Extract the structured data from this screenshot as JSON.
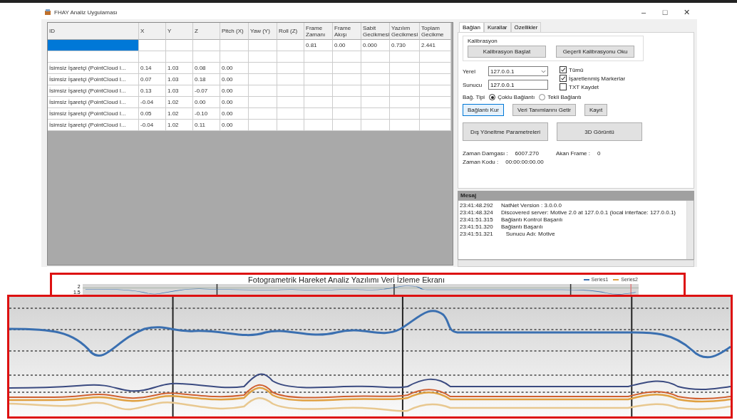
{
  "window": {
    "title": "FHAY Analiz Uygulaması",
    "controls": [
      "–",
      "□",
      "✕"
    ]
  },
  "table": {
    "columns": [
      "ID",
      "X",
      "Y",
      "Z",
      "Pitch (X)",
      "Yaw (Y)",
      "Roll (Z)",
      "Frame Zamanı",
      "Frame Akışı",
      "Sabit Gecikmesi",
      "Yazılım Gecikmesi",
      "Toplam Gecikme"
    ],
    "rows": [
      {
        "selected": true,
        "cells": [
          null,
          null,
          null,
          null,
          null,
          null,
          null,
          "0.81",
          "0.00",
          "0.000",
          "0.730",
          "2.441"
        ]
      },
      {
        "selected": false,
        "cells": []
      },
      {
        "selected": false,
        "cells": [
          "İsimsiz İşaretçi (PointCloud I...",
          "0.14",
          "1.03",
          "0.08",
          "0.00"
        ]
      },
      {
        "selected": false,
        "cells": [
          "İsimsiz İşaretçi (PointCloud I...",
          "0.07",
          "1.03",
          "0.18",
          "0.00"
        ]
      },
      {
        "selected": false,
        "cells": [
          "İsimsiz İşaretçi (PointCloud I...",
          "0.13",
          "1.03",
          "-0.07",
          "0.00"
        ]
      },
      {
        "selected": false,
        "cells": [
          "İsimsiz İşaretçi (PointCloud I...",
          "-0.04",
          "1.02",
          "0.00",
          "0.00"
        ]
      },
      {
        "selected": false,
        "cells": [
          "İsimsiz İşaretçi (PointCloud I...",
          "0.05",
          "1.02",
          "-0.10",
          "0.00"
        ]
      },
      {
        "selected": false,
        "cells": [
          "İsimsiz İşaretçi (PointCloud I...",
          "-0.04",
          "1.02",
          "0.11",
          "0.00"
        ]
      }
    ]
  },
  "panel": {
    "tabs": [
      {
        "label": "Bağlan",
        "selected": true
      },
      {
        "label": "Kurallar",
        "selected": false
      },
      {
        "label": "Özellikler",
        "selected": false
      }
    ],
    "calibration": {
      "title": "Kalibrasyon",
      "buttons": [
        {
          "label": "Kalibrasyon Başlat",
          "focused": false
        },
        {
          "label": "Geçerli Kalibrasyonu Oku",
          "focused": false
        }
      ]
    },
    "local": {
      "label": "Yerel",
      "value": "127.0.0.1"
    },
    "server": {
      "label": "Sunucu",
      "value": "127.0.0.1"
    },
    "checkboxes": [
      {
        "label": "Tümü",
        "checked": true
      },
      {
        "label": "İşaretlenmiş Markerlar",
        "checked": true
      },
      {
        "label": "TXT Kaydet",
        "checked": false
      }
    ],
    "connection_type": {
      "label": "Bağ. Tipi",
      "options": [
        {
          "label": "Çoklu Bağlantı",
          "selected": true
        },
        {
          "label": "Tekli Bağlantı",
          "selected": false
        }
      ]
    },
    "buttons": [
      {
        "label": "Bağlantı Kur",
        "focused": true
      },
      {
        "label": "Veri Tanımlarını Getir",
        "focused": false
      },
      {
        "label": "Kayıt",
        "focused": false
      }
    ],
    "big_buttons": [
      {
        "label": "Dış Yöneltme Parametreleri",
        "focused": false
      },
      {
        "label": "3D Görüntü",
        "focused": false
      }
    ],
    "info": [
      {
        "label": "Zaman Damgası :",
        "value": "6007.270"
      },
      {
        "label": "Akan Frame :",
        "value": "0"
      },
      {
        "label": "Zaman Kodu   :",
        "value": "00:00:00:00.00"
      }
    ],
    "messages": {
      "title": "Mesaj",
      "lines": [
        {
          "time": "23:41:48.292",
          "text": "NatNet Version : 3.0.0.0"
        },
        {
          "time": "23:41:48.324",
          "text": "Discovered server: Motive 2.0 at 127.0.0.1 (local interface: 127.0.0.1)"
        },
        {
          "time": "23:41:51.315",
          "text": "Bağlantı Kontrol Başarılı"
        },
        {
          "time": "23:41:51.320",
          "text": "Bağlantı Başarılı"
        },
        {
          "time": "23:41:51.321",
          "text": "   Sunucu Adı: Motive"
        }
      ]
    }
  },
  "chart": {
    "title": "Fotogrametrik Hareket Analiz Yazılımı Veri İzleme Ekranı",
    "legend": [
      {
        "name": "Series1",
        "color": "#3a6fb0"
      },
      {
        "name": "Series2",
        "color": "#e0a040"
      }
    ],
    "y_tick_labels": [
      "2",
      "1.5"
    ]
  }
}
